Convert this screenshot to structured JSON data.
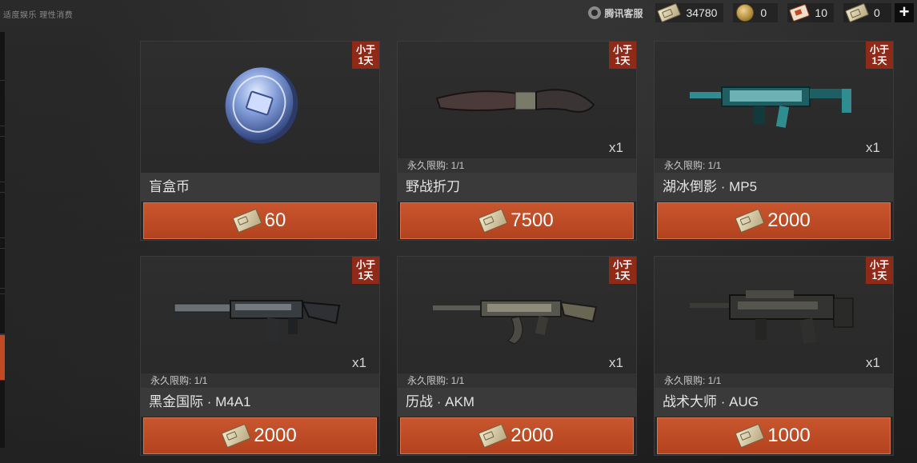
{
  "notice": "适度娱乐 理性消费",
  "topbar": {
    "service_label": "腾讯客服",
    "currencies": [
      {
        "icon": "ticket-icon",
        "value": "34780"
      },
      {
        "icon": "gold-coin-icon",
        "value": "0"
      },
      {
        "icon": "card-voucher-icon",
        "value": "10"
      },
      {
        "icon": "ticket-icon",
        "value": "0"
      }
    ],
    "add_symbol": "+"
  },
  "items": [
    {
      "tag_line1": "小于",
      "tag_line2": "1天",
      "qty": "",
      "limit": "",
      "name": "盲盒币",
      "price": "60",
      "art": "blind-box-coin"
    },
    {
      "tag_line1": "小于",
      "tag_line2": "1天",
      "qty": "x1",
      "limit": "永久限购: 1/1",
      "name": "野战折刀",
      "price": "7500",
      "art": "knife"
    },
    {
      "tag_line1": "小于",
      "tag_line2": "1天",
      "qty": "x1",
      "limit": "永久限购: 1/1",
      "name": "湖冰倒影 · MP5",
      "price": "2000",
      "art": "mp5"
    },
    {
      "tag_line1": "小于",
      "tag_line2": "1天",
      "qty": "x1",
      "limit": "永久限购: 1/1",
      "name": "黑金国际 · M4A1",
      "price": "2000",
      "art": "m4a1"
    },
    {
      "tag_line1": "小于",
      "tag_line2": "1天",
      "qty": "x1",
      "limit": "永久限购: 1/1",
      "name": "历战 · AKM",
      "price": "2000",
      "art": "akm"
    },
    {
      "tag_line1": "小于",
      "tag_line2": "1天",
      "qty": "x1",
      "limit": "永久限购: 1/1",
      "name": "战术大师 · AUG",
      "price": "1000",
      "art": "aug"
    }
  ]
}
